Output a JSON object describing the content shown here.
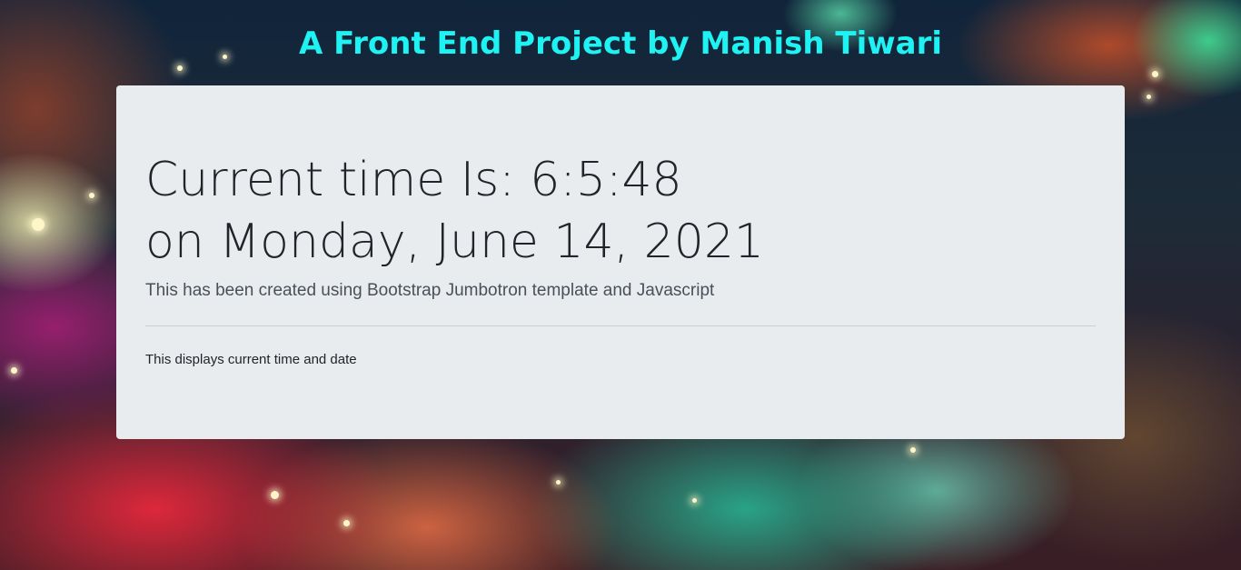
{
  "header": {
    "title": "A Front End Project by Manish Tiwari"
  },
  "jumbotron": {
    "time_prefix": "Current time Is: ",
    "time_value": "6:5:48",
    "date_prefix": "on ",
    "date_value": "Monday, June 14, 2021",
    "lead": "This has been created using Bootstrap Jumbotron template and Javascript",
    "description": "This displays current time and date"
  },
  "colors": {
    "title": "#1ff2f2",
    "panel_background": "#e9ecef",
    "text": "#212529"
  }
}
